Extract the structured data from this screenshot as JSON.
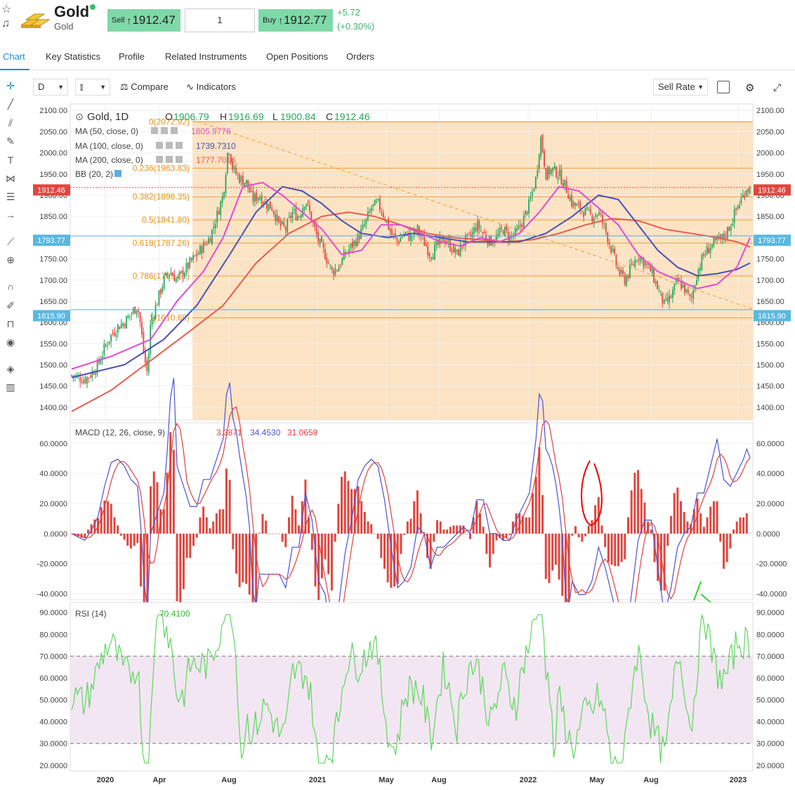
{
  "header": {
    "instrument_name": "Gold",
    "instrument_sub": "Gold",
    "sell_label": "Sell",
    "sell_price": "1912.47",
    "quantity": "1",
    "buy_label": "Buy",
    "buy_price": "1912.77",
    "change_abs": "+5.72",
    "change_pct": "(+0.30%)",
    "arrow": "↑"
  },
  "tabs": [
    "Chart",
    "Key Statistics",
    "Profile",
    "Related Instruments",
    "Open Positions",
    "Orders"
  ],
  "toolbar": {
    "timeframe": "D",
    "compare": "Compare",
    "indicators": "Indicators",
    "rate": "Sell Rate"
  },
  "legend": {
    "title": "Gold, 1D",
    "o_label": "O",
    "o": "1906.79",
    "h_label": "H",
    "h": "1916.69",
    "l_label": "L",
    "l": "1900.84",
    "c_label": "C",
    "c": "1912.46",
    "ma50": "MA (50, close, 0)",
    "ma50_val": "1805.9776",
    "ma100": "MA (100, close, 0)",
    "ma100_val": "1739.7310",
    "ma200": "MA (200, close, 0)",
    "ma200_val": "1777.7016",
    "bb": "BB (20, 2)",
    "macd": "MACD (12, 26, close, 9)",
    "macd_hist": "3.3871",
    "macd_line": "34.4530",
    "macd_signal": "31.0659",
    "rsi": "RSI (14)",
    "rsi_val": "70.4100"
  },
  "colors": {
    "up": "#26a65b",
    "down": "#e0473f",
    "fib_fill": "#fbe3c4",
    "ma50": "#e24bd1",
    "ma100": "#4a4fb5",
    "ma200": "#e85b4a",
    "macd": "#4b52d6",
    "signal": "#e04040",
    "rsi": "#5ed65e",
    "rsi_band": "#f2e6f2",
    "accent": "#1a8fd3"
  },
  "chart_data": {
    "type": "candlestick",
    "price_axis": {
      "ticks": [
        "2100.00",
        "2050.00",
        "2000.00",
        "1950.00",
        "1900.00",
        "1850.00",
        "1800.00",
        "1750.00",
        "1700.00",
        "1650.00",
        "1600.00",
        "1550.00",
        "1500.00",
        "1450.00",
        "1400.00"
      ],
      "ylim": [
        1370,
        2112
      ]
    },
    "price_badges": [
      "1912.46",
      "1793.77",
      "1615.90"
    ],
    "fib_levels": [
      {
        "label": "0(2072.92)",
        "value": 2072.92
      },
      {
        "label": "0.236(1963.83)",
        "value": 1963.83
      },
      {
        "label": "0.382(1896.35)",
        "value": 1896.35
      },
      {
        "label": "0.5(1841.80)",
        "value": 1841.8
      },
      {
        "label": "0.618(1787.26)",
        "value": 1787.26
      },
      {
        "label": "0.786(1709.61)",
        "value": 1709.61
      },
      {
        "label": "1(1610.69)",
        "value": 1610.69
      }
    ],
    "x_axis": {
      "ticks": [
        "2020",
        "Apr",
        "Aug",
        "2021",
        "May",
        "Aug",
        "2022",
        "May",
        "Aug",
        "2023"
      ]
    },
    "close_path": [
      [
        0,
        1475
      ],
      [
        10,
        1470
      ],
      [
        20,
        1465
      ],
      [
        30,
        1480
      ],
      [
        40,
        1500
      ],
      [
        50,
        1540
      ],
      [
        60,
        1570
      ],
      [
        70,
        1590
      ],
      [
        80,
        1600
      ],
      [
        90,
        1620
      ],
      [
        100,
        1640
      ],
      [
        105,
        1590
      ],
      [
        110,
        1520
      ],
      [
        115,
        1480
      ],
      [
        120,
        1600
      ],
      [
        130,
        1650
      ],
      [
        140,
        1700
      ],
      [
        150,
        1720
      ],
      [
        160,
        1700
      ],
      [
        170,
        1720
      ],
      [
        180,
        1740
      ],
      [
        190,
        1760
      ],
      [
        200,
        1780
      ],
      [
        210,
        1800
      ],
      [
        220,
        1850
      ],
      [
        230,
        1900
      ],
      [
        238,
        2020
      ],
      [
        245,
        1960
      ],
      [
        255,
        1940
      ],
      [
        265,
        1930
      ],
      [
        275,
        1890
      ],
      [
        285,
        1900
      ],
      [
        295,
        1880
      ],
      [
        305,
        1870
      ],
      [
        315,
        1830
      ],
      [
        325,
        1820
      ],
      [
        335,
        1860
      ],
      [
        345,
        1850
      ],
      [
        355,
        1890
      ],
      [
        365,
        1840
      ],
      [
        375,
        1790
      ],
      [
        385,
        1760
      ],
      [
        395,
        1720
      ],
      [
        405,
        1730
      ],
      [
        415,
        1760
      ],
      [
        425,
        1780
      ],
      [
        435,
        1800
      ],
      [
        445,
        1830
      ],
      [
        455,
        1870
      ],
      [
        465,
        1880
      ],
      [
        475,
        1850
      ],
      [
        485,
        1810
      ],
      [
        495,
        1790
      ],
      [
        505,
        1810
      ],
      [
        515,
        1800
      ],
      [
        525,
        1820
      ],
      [
        535,
        1790
      ],
      [
        545,
        1760
      ],
      [
        555,
        1780
      ],
      [
        565,
        1800
      ],
      [
        575,
        1780
      ],
      [
        585,
        1760
      ],
      [
        595,
        1790
      ],
      [
        605,
        1800
      ],
      [
        615,
        1830
      ],
      [
        625,
        1810
      ],
      [
        635,
        1790
      ],
      [
        645,
        1800
      ],
      [
        655,
        1820
      ],
      [
        665,
        1800
      ],
      [
        675,
        1810
      ],
      [
        685,
        1840
      ],
      [
        695,
        1880
      ],
      [
        705,
        1940
      ],
      [
        712,
        2040
      ],
      [
        720,
        1950
      ],
      [
        730,
        1960
      ],
      [
        740,
        1950
      ],
      [
        750,
        1920
      ],
      [
        760,
        1880
      ],
      [
        770,
        1870
      ],
      [
        780,
        1860
      ],
      [
        790,
        1850
      ],
      [
        800,
        1860
      ],
      [
        810,
        1820
      ],
      [
        820,
        1770
      ],
      [
        830,
        1720
      ],
      [
        840,
        1700
      ],
      [
        850,
        1730
      ],
      [
        860,
        1760
      ],
      [
        870,
        1740
      ],
      [
        880,
        1720
      ],
      [
        890,
        1680
      ],
      [
        900,
        1640
      ],
      [
        910,
        1660
      ],
      [
        920,
        1700
      ],
      [
        930,
        1680
      ],
      [
        940,
        1650
      ],
      [
        950,
        1720
      ],
      [
        960,
        1760
      ],
      [
        970,
        1780
      ],
      [
        980,
        1790
      ],
      [
        990,
        1800
      ],
      [
        1000,
        1830
      ],
      [
        1010,
        1870
      ],
      [
        1020,
        1900
      ],
      [
        1025,
        1920
      ],
      [
        1030,
        1912
      ]
    ],
    "ma50_path": [
      [
        0,
        1490
      ],
      [
        60,
        1520
      ],
      [
        120,
        1560
      ],
      [
        160,
        1650
      ],
      [
        200,
        1720
      ],
      [
        230,
        1800
      ],
      [
        260,
        1920
      ],
      [
        290,
        1930
      ],
      [
        320,
        1900
      ],
      [
        350,
        1860
      ],
      [
        380,
        1820
      ],
      [
        410,
        1760
      ],
      [
        440,
        1770
      ],
      [
        470,
        1830
      ],
      [
        500,
        1830
      ],
      [
        530,
        1810
      ],
      [
        560,
        1790
      ],
      [
        590,
        1780
      ],
      [
        620,
        1800
      ],
      [
        650,
        1790
      ],
      [
        680,
        1810
      ],
      [
        710,
        1860
      ],
      [
        740,
        1920
      ],
      [
        770,
        1910
      ],
      [
        800,
        1870
      ],
      [
        830,
        1830
      ],
      [
        860,
        1760
      ],
      [
        890,
        1720
      ],
      [
        920,
        1700
      ],
      [
        950,
        1680
      ],
      [
        980,
        1690
      ],
      [
        1010,
        1730
      ],
      [
        1030,
        1800
      ]
    ],
    "ma100_path": [
      [
        0,
        1470
      ],
      [
        80,
        1500
      ],
      [
        140,
        1560
      ],
      [
        190,
        1640
      ],
      [
        240,
        1760
      ],
      [
        280,
        1860
      ],
      [
        320,
        1920
      ],
      [
        350,
        1910
      ],
      [
        380,
        1880
      ],
      [
        410,
        1840
      ],
      [
        440,
        1810
      ],
      [
        480,
        1800
      ],
      [
        520,
        1810
      ],
      [
        560,
        1800
      ],
      [
        600,
        1790
      ],
      [
        640,
        1790
      ],
      [
        680,
        1790
      ],
      [
        720,
        1810
      ],
      [
        760,
        1850
      ],
      [
        800,
        1900
      ],
      [
        830,
        1890
      ],
      [
        860,
        1830
      ],
      [
        890,
        1770
      ],
      [
        920,
        1730
      ],
      [
        950,
        1710
      ],
      [
        980,
        1715
      ],
      [
        1010,
        1725
      ],
      [
        1030,
        1740
      ]
    ],
    "ma200_path": [
      [
        0,
        1390
      ],
      [
        60,
        1440
      ],
      [
        120,
        1510
      ],
      [
        180,
        1580
      ],
      [
        230,
        1640
      ],
      [
        280,
        1740
      ],
      [
        330,
        1810
      ],
      [
        380,
        1850
      ],
      [
        420,
        1860
      ],
      [
        460,
        1850
      ],
      [
        500,
        1830
      ],
      [
        540,
        1810
      ],
      [
        580,
        1800
      ],
      [
        620,
        1795
      ],
      [
        660,
        1790
      ],
      [
        700,
        1795
      ],
      [
        740,
        1810
      ],
      [
        780,
        1830
      ],
      [
        820,
        1845
      ],
      [
        860,
        1840
      ],
      [
        900,
        1820
      ],
      [
        940,
        1810
      ],
      [
        980,
        1800
      ],
      [
        1010,
        1790
      ],
      [
        1030,
        1778
      ]
    ],
    "macd_axis": {
      "ticks": [
        "60.0000",
        "40.0000",
        "20.0000",
        "0.0000",
        "-20.0000",
        "-40.0000"
      ],
      "ylim": [
        -43,
        70
      ]
    },
    "rsi_axis": {
      "ticks": [
        "90.0000",
        "80.0000",
        "70.0000",
        "60.0000",
        "50.0000",
        "40.0000",
        "30.0000",
        "20.0000"
      ],
      "ylim": [
        18,
        92
      ],
      "band": [
        30,
        70
      ]
    }
  }
}
